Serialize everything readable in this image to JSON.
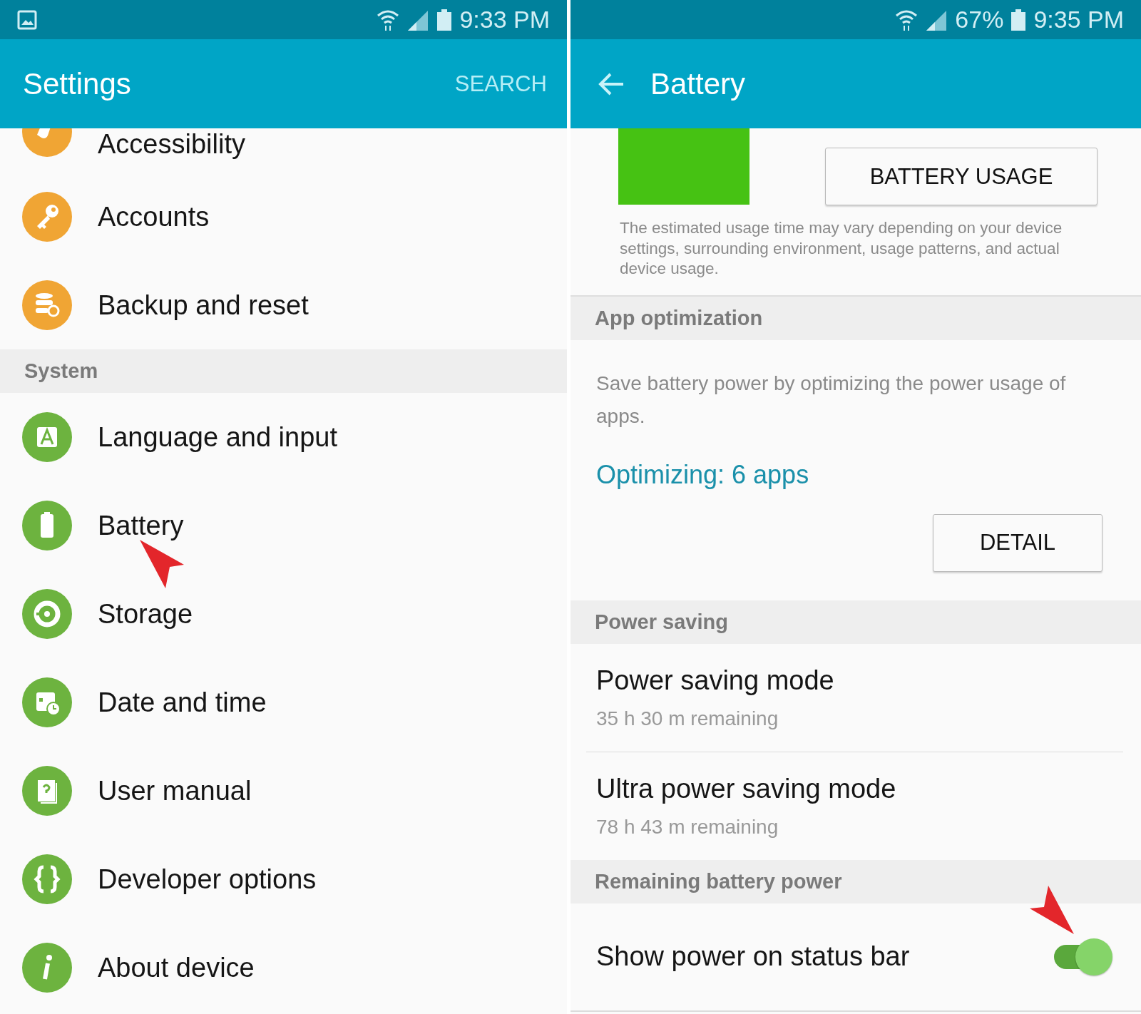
{
  "settings_screen": {
    "status_bar": {
      "time": "9:33 PM"
    },
    "app_bar": {
      "title": "Settings",
      "action": "SEARCH"
    },
    "list": [
      {
        "kind": "item",
        "label": "Accessibility",
        "color": "#f0a534"
      },
      {
        "kind": "item",
        "label": "Accounts",
        "color": "#f0a534"
      },
      {
        "kind": "item",
        "label": "Backup and reset",
        "color": "#f0a534"
      },
      {
        "kind": "header",
        "label": "System"
      },
      {
        "kind": "item",
        "label": "Language and input",
        "color": "#6db33f"
      },
      {
        "kind": "item",
        "label": "Battery",
        "color": "#6db33f"
      },
      {
        "kind": "item",
        "label": "Storage",
        "color": "#6db33f"
      },
      {
        "kind": "item",
        "label": "Date and time",
        "color": "#6db33f"
      },
      {
        "kind": "item",
        "label": "User manual",
        "color": "#6db33f"
      },
      {
        "kind": "item",
        "label": "Developer options",
        "color": "#6db33f"
      },
      {
        "kind": "item",
        "label": "About device",
        "color": "#6db33f"
      }
    ]
  },
  "battery_screen": {
    "status_bar": {
      "battery_percent": "67%",
      "time": "9:35 PM"
    },
    "app_bar": {
      "title": "Battery"
    },
    "usage_button": "BATTERY USAGE",
    "note": "The estimated usage time may vary depending on your device settings, surrounding environment, usage patterns, and actual device usage.",
    "app_optimization": {
      "header": "App optimization",
      "description": "Save battery power by optimizing the power usage of apps.",
      "link": "Optimizing: 6 apps",
      "button": "DETAIL"
    },
    "power_saving": {
      "header": "Power saving",
      "items": [
        {
          "title": "Power saving mode",
          "subtitle": "35 h 30 m remaining"
        },
        {
          "title": "Ultra power saving mode",
          "subtitle": "78 h 43 m remaining"
        }
      ]
    },
    "remaining_power": {
      "header": "Remaining battery power",
      "toggle": {
        "label": "Show power on status bar",
        "on": true
      }
    }
  }
}
